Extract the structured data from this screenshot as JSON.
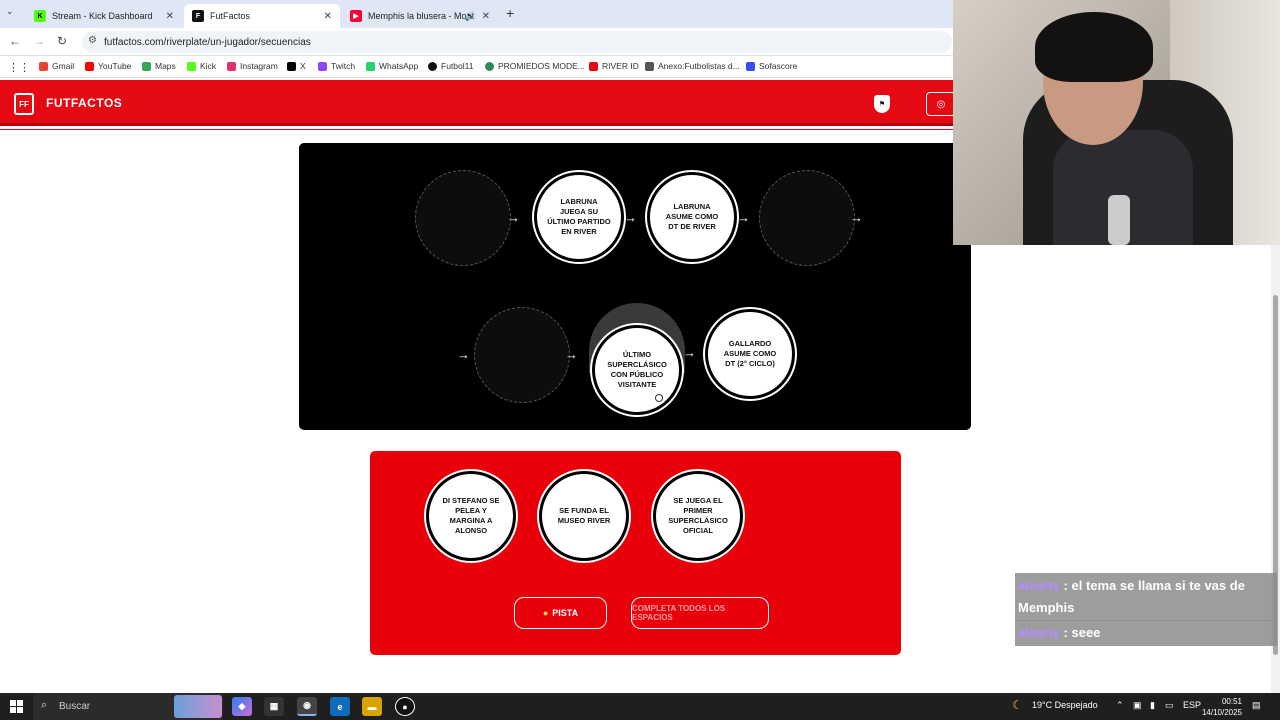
{
  "browser": {
    "tabs": [
      {
        "label": "Stream - Kick Dashboard",
        "icon": "kick-icon",
        "color": "#53fc18"
      },
      {
        "label": "FutFactos",
        "icon": "futfactos-icon",
        "color": "#111111"
      },
      {
        "label": "Memphis la blusera - Mont",
        "icon": "youtube-icon",
        "color": "#ff0033"
      }
    ],
    "url": "futfactos.com/riverplate/un-jugador/secuencias",
    "bookmarks": [
      {
        "label": "Gmail",
        "color": "#ea4335"
      },
      {
        "label": "YouTube",
        "color": "#ff0000"
      },
      {
        "label": "Maps",
        "color": "#34a853"
      },
      {
        "label": "Kick",
        "color": "#53fc18"
      },
      {
        "label": "Instagram",
        "color": "#e1306c"
      },
      {
        "label": "X",
        "color": "#000000"
      },
      {
        "label": "Twitch",
        "color": "#9146ff"
      },
      {
        "label": "WhatsApp",
        "color": "#25d366"
      },
      {
        "label": "Futbol11",
        "color": "#111111"
      },
      {
        "label": "PROMIEDOS MODE...",
        "color": "#2e8b57"
      },
      {
        "label": "RIVER ID",
        "color": "#e50914"
      },
      {
        "label": "Anexo:Futbolistas d...",
        "color": "#555555"
      },
      {
        "label": "Sofascore",
        "color": "#374df5"
      }
    ]
  },
  "site": {
    "logo_text": "FUTFACTOS",
    "accent": "#e50914"
  },
  "board": {
    "row1": [
      {
        "type": "empty"
      },
      {
        "type": "card",
        "text": "LABRUNA JUEGA SU ÚLTIMO PARTIDO EN RIVER"
      },
      {
        "type": "card",
        "text": "LABRUNA ASUME COMO DT DE RIVER"
      },
      {
        "type": "empty"
      }
    ],
    "row2": [
      {
        "type": "empty"
      },
      {
        "type": "card",
        "text": "ÚLTIMO SUPERCLÁSICO CON PÚBLICO VISITANTE"
      },
      {
        "type": "card",
        "text": "GALLARDO ASUME COMO DT (2° CICLO)"
      }
    ]
  },
  "pool": {
    "cards": [
      "DI STEFANO SE PELEA Y MARGINA A ALONSO",
      "SE FUNDA EL MUSEO RIVER",
      "SE JUEGA EL PRIMER SUPERCLÁSICO OFICIAL"
    ],
    "hint_label": "PISTA",
    "complete_label": "COMPLETA TODOS LOS ESPACIOS"
  },
  "chat": [
    {
      "user": "alearty",
      "message": ": el tema se llama si te vas de Memphis"
    },
    {
      "user": "alearty",
      "message": ": seee"
    }
  ],
  "taskbar": {
    "search_placeholder": "Buscar",
    "weather": "19°C  Despejado",
    "lang": "ESP",
    "time": "00:51",
    "date": "14/10/2025"
  }
}
